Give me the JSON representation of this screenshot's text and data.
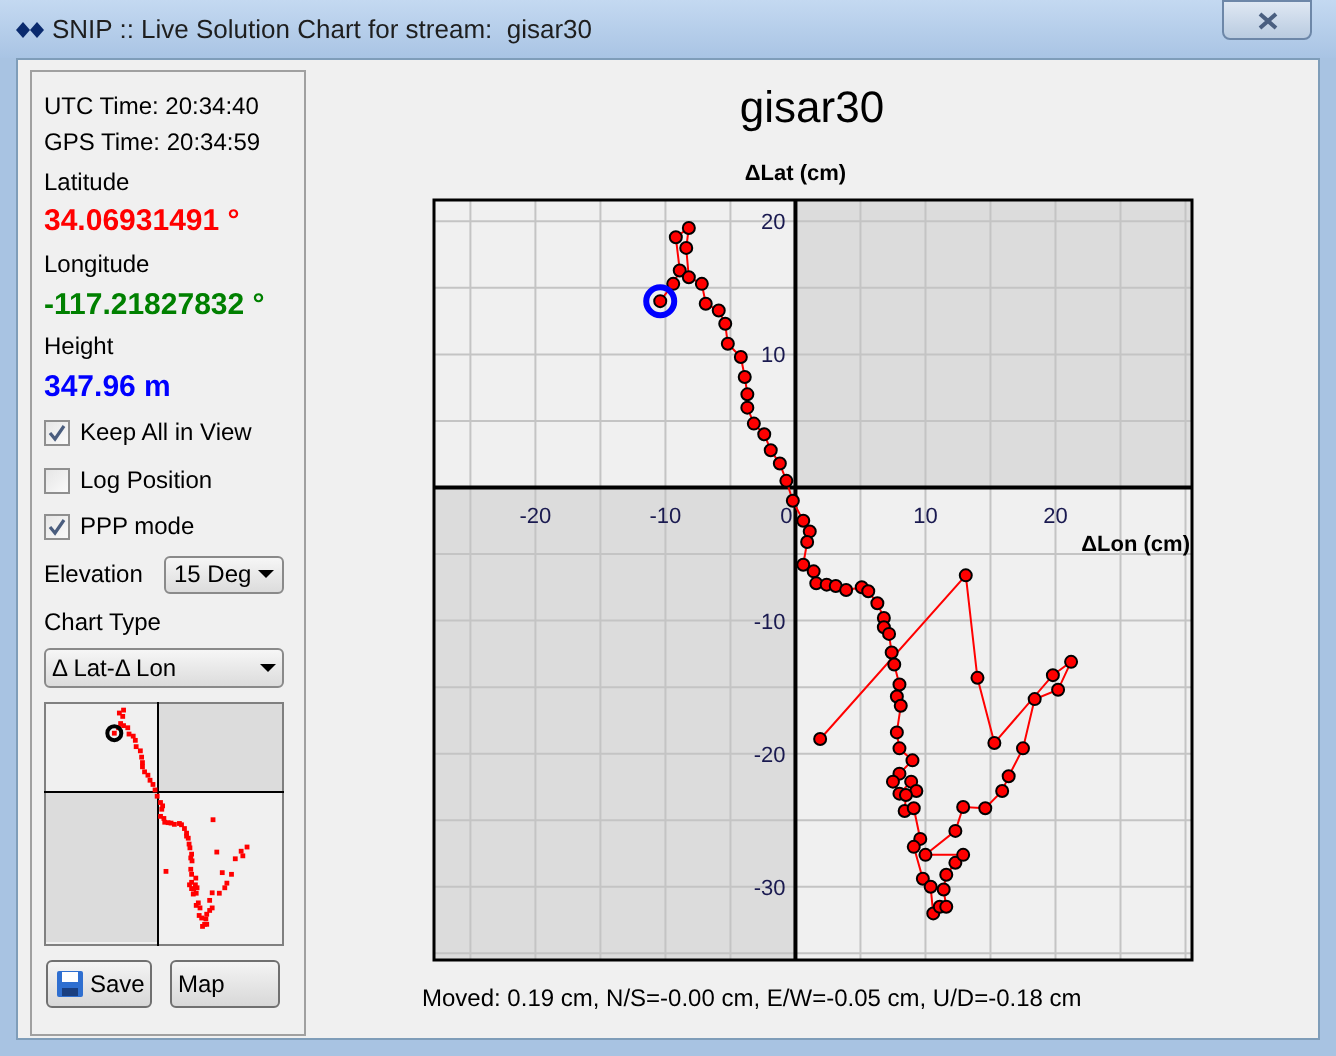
{
  "window": {
    "title": "SNIP :: Live Solution Chart for stream:  gisar30"
  },
  "panel": {
    "utc_time": "UTC Time: 20:34:40",
    "gps_time": "GPS Time: 20:34:59",
    "latitude_label": "Latitude",
    "latitude": "34.06931491 °",
    "longitude_label": "Longitude",
    "longitude": "-117.21827832 °",
    "height_label": "Height",
    "height": "347.96 m",
    "options": [
      {
        "label": "Keep All in View",
        "checked": true
      },
      {
        "label": "Log Position",
        "checked": false
      },
      {
        "label": "PPP mode",
        "checked": true
      }
    ],
    "elevation": {
      "label": "Elevation",
      "value": "15 Deg"
    },
    "chart_type": {
      "label": "Chart Type",
      "value": "Δ Lat-Δ Lon"
    },
    "buttons": [
      {
        "label": "Save",
        "kind": "save"
      },
      {
        "label": "Map",
        "kind": "plain"
      }
    ]
  },
  "chart": {
    "title": "gisar30",
    "chart_data": {
      "type": "line",
      "xlabel": "ΔLon (cm)",
      "ylabel": "ΔLat (cm)",
      "xlim": [
        -27.8,
        30.5
      ],
      "ylim": [
        -35.5,
        21.6
      ],
      "xticks": [
        -20,
        -10,
        0,
        10,
        20
      ],
      "yticks": [
        -30,
        -20,
        -10,
        10,
        20
      ],
      "grid": true,
      "x": [
        -10.4,
        -9.4,
        -8.9,
        -9.2,
        -8.2,
        -8.4,
        -8.2,
        -7.2,
        -6.9,
        -5.9,
        -5.4,
        -5.2,
        -4.2,
        -3.9,
        -3.7,
        -3.7,
        -3.2,
        -2.4,
        -1.9,
        -1.2,
        -0.7,
        -0.2,
        0.6,
        1.1,
        0.9,
        0.6,
        1.4,
        1.6,
        2.4,
        3.1,
        3.9,
        5.1,
        5.6,
        6.3,
        6.8,
        6.8,
        7.2,
        7.4,
        7.6,
        8,
        7.8,
        8.1,
        7.8,
        8,
        9,
        8,
        7.5,
        8,
        8.9,
        9.3,
        8.5,
        8.4,
        9.1,
        9.6,
        9.1,
        9.8,
        10.4,
        10.6,
        11.1,
        11.6,
        11.4,
        11.6,
        12.3,
        12.9,
        10,
        12.3,
        12.9,
        14.6,
        15.9,
        16.4,
        17.5,
        18.4,
        20.2,
        21.2,
        19.8,
        15.3,
        14,
        13.1,
        1.9
      ],
      "series": [
        {
          "color": "#ff0000",
          "marker": "circle",
          "values": [
            14,
            15.3,
            16.3,
            18.8,
            19.5,
            18,
            15.8,
            15.3,
            13.8,
            13.3,
            12.3,
            10.8,
            9.8,
            8.3,
            7,
            6,
            4.8,
            4,
            2.8,
            1.8,
            0.5,
            -1,
            -2.5,
            -3.3,
            -4.1,
            -5.8,
            -6.3,
            -7.2,
            -7.3,
            -7.4,
            -7.7,
            -7.5,
            -7.8,
            -8.7,
            -9.8,
            -10.5,
            -11,
            -12.4,
            -13.3,
            -14.8,
            -15.7,
            -16.4,
            -18.4,
            -19.6,
            -20.5,
            -21.5,
            -22.1,
            -23,
            -22.1,
            -22.8,
            -23.1,
            -24.3,
            -24.1,
            -26.4,
            -27,
            -29.4,
            -30,
            -32,
            -31.5,
            -31.5,
            -30.2,
            -29.1,
            -28.2,
            -27.6,
            -27.6,
            -25.8,
            -24,
            -24.1,
            -22.8,
            -21.7,
            -19.6,
            -15.9,
            -15.2,
            -13.1,
            -14.1,
            -19.2,
            -14.3,
            -6.6,
            -18.9
          ]
        }
      ]
    }
  },
  "status": "Moved: 0.19 cm, N/S=-0.00 cm, E/W=-0.05 cm, U/D=-0.18 cm"
}
